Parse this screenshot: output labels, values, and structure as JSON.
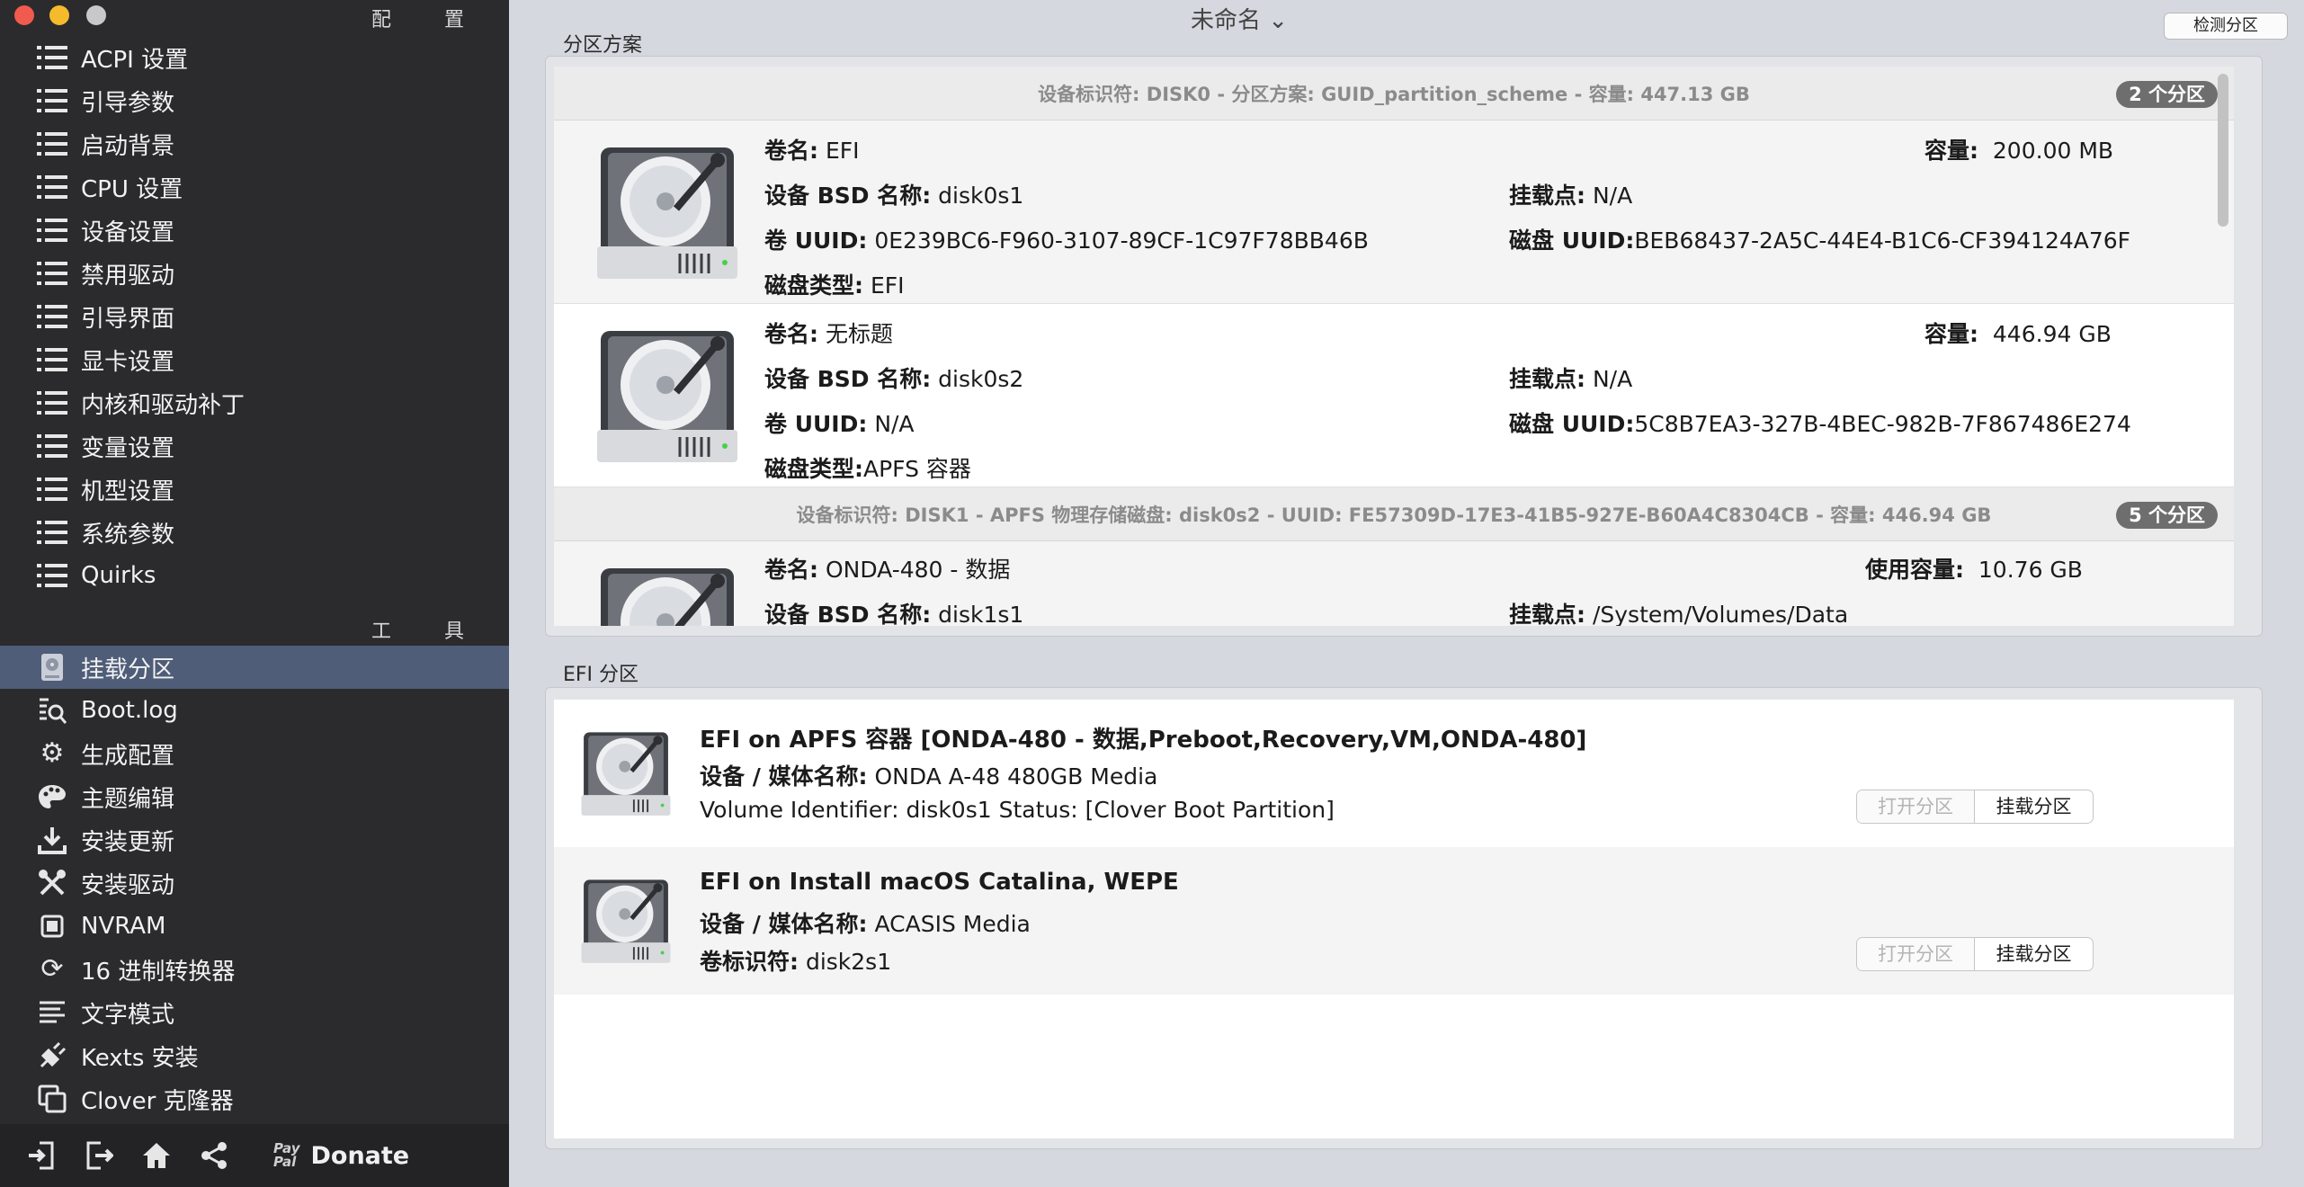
{
  "window": {
    "title": "未命名 ⌄"
  },
  "sidebar": {
    "config_header": "配 置",
    "config_items": [
      {
        "label": "ACPI 设置"
      },
      {
        "label": "引导参数"
      },
      {
        "label": "启动背景"
      },
      {
        "label": "CPU 设置"
      },
      {
        "label": "设备设置"
      },
      {
        "label": "禁用驱动"
      },
      {
        "label": "引导界面"
      },
      {
        "label": "显卡设置"
      },
      {
        "label": "内核和驱动补丁"
      },
      {
        "label": "变量设置"
      },
      {
        "label": "机型设置"
      },
      {
        "label": "系统参数"
      },
      {
        "label": "Quirks"
      }
    ],
    "tools_header": "工 具",
    "tool_items": [
      {
        "label": "挂载分区",
        "icon": "disk-icon",
        "active": true
      },
      {
        "label": "Boot.log",
        "icon": "log-search-icon"
      },
      {
        "label": "生成配置",
        "icon": "gears-icon"
      },
      {
        "label": "主题编辑",
        "icon": "palette-icon"
      },
      {
        "label": "安装更新",
        "icon": "download-icon"
      },
      {
        "label": "安装驱动",
        "icon": "wrench-icon"
      },
      {
        "label": "NVRAM",
        "icon": "chip-icon"
      },
      {
        "label": "16 进制转换器",
        "icon": "refresh-icon"
      },
      {
        "label": "文字模式",
        "icon": "text-lines-icon"
      },
      {
        "label": "Kexts 安装",
        "icon": "plug-icon"
      },
      {
        "label": "Clover 克隆器",
        "icon": "clone-icon"
      }
    ],
    "bottom": {
      "paypal_line1": "Pay",
      "paypal_line2": "Pal",
      "donate_label": "Donate"
    }
  },
  "toolbar": {
    "detect_button": "检测分区"
  },
  "partition_scheme": {
    "group_label": "分区方案",
    "disk0": {
      "header": "设备标识符: DISK0 - 分区方案: GUID_partition_scheme - 容量: 447.13 GB",
      "badge": "2 个分区",
      "partitions": [
        {
          "vol_name_label": "卷名:",
          "vol_name": "EFI",
          "capacity_label": "容量:",
          "capacity": "200.00 MB",
          "bsd_label": "设备 BSD 名称:",
          "bsd": "disk0s1",
          "mount_label": "挂载点:",
          "mount": "N/A",
          "uuid_label": "卷 UUID:",
          "uuid": "0E239BC6-F960-3107-89CF-1C97F78BB46B",
          "disk_uuid_label": "磁盘 UUID:",
          "disk_uuid": "BEB68437-2A5C-44E4-B1C6-CF394124A76F",
          "type_label": "磁盘类型:",
          "type": "EFI"
        },
        {
          "vol_name_label": "卷名:",
          "vol_name": "无标题",
          "capacity_label": "容量:",
          "capacity": "446.94 GB",
          "bsd_label": "设备 BSD 名称:",
          "bsd": "disk0s2",
          "mount_label": "挂载点:",
          "mount": "N/A",
          "uuid_label": "卷 UUID:",
          "uuid": "N/A",
          "disk_uuid_label": "磁盘 UUID:",
          "disk_uuid": "5C8B7EA3-327B-4BEC-982B-7F867486E274",
          "type_label": "磁盘类型:",
          "type": "APFS 容器"
        }
      ]
    },
    "disk1": {
      "header": "设备标识符: DISK1 - APFS 物理存储磁盘: disk0s2 - UUID: FE57309D-17E3-41B5-927E-B60A4C8304CB - 容量: 446.94 GB",
      "badge": "5 个分区",
      "partitions": [
        {
          "vol_name_label": "卷名:",
          "vol_name": "ONDA-480 - 数据",
          "capacity_label": "使用容量:",
          "capacity": "10.76 GB",
          "bsd_label": "设备 BSD 名称:",
          "bsd": "disk1s1",
          "mount_label": "挂载点:",
          "mount": "/System/Volumes/Data"
        }
      ]
    }
  },
  "efi_partitions": {
    "group_label": "EFI 分区",
    "items": [
      {
        "title": "EFI on APFS 容器 [ONDA-480 - 数据,Preboot,Recovery,VM,ONDA-480]",
        "line1_label": "设备 / 媒体名称:",
        "line1_value": "ONDA A-48 480GB Media",
        "line2": "Volume Identifier: disk0s1 Status: [Clover Boot Partition]",
        "open_button": "打开分区",
        "mount_button": "挂载分区"
      },
      {
        "title": "EFI on Install macOS Catalina, WEPE",
        "line1_label": "设备 / 媒体名称:",
        "line1_value": "ACASIS Media",
        "line2_label": "卷标识符:",
        "line2_value": "disk2s1",
        "open_button": "打开分区",
        "mount_button": "挂载分区"
      }
    ]
  }
}
